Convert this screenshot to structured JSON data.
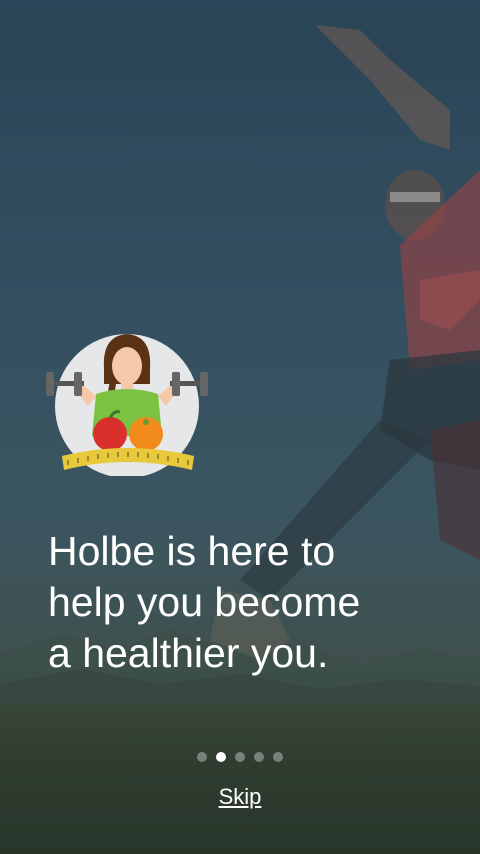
{
  "onboarding": {
    "headline_line1": "Holbe is here to",
    "headline_line2": "help you become",
    "headline_line3": "a healthier you.",
    "skip_label": "Skip",
    "page_indicator": {
      "total": 5,
      "active_index": 1
    }
  },
  "colors": {
    "text": "#ffffff",
    "dot_active": "#ffffff",
    "dot_inactive": "rgba(255,255,255,0.35)",
    "shirt": "#7cc242",
    "apple": "#d9302c",
    "orange": "#f28a1c",
    "tape": "#e8c93c"
  }
}
